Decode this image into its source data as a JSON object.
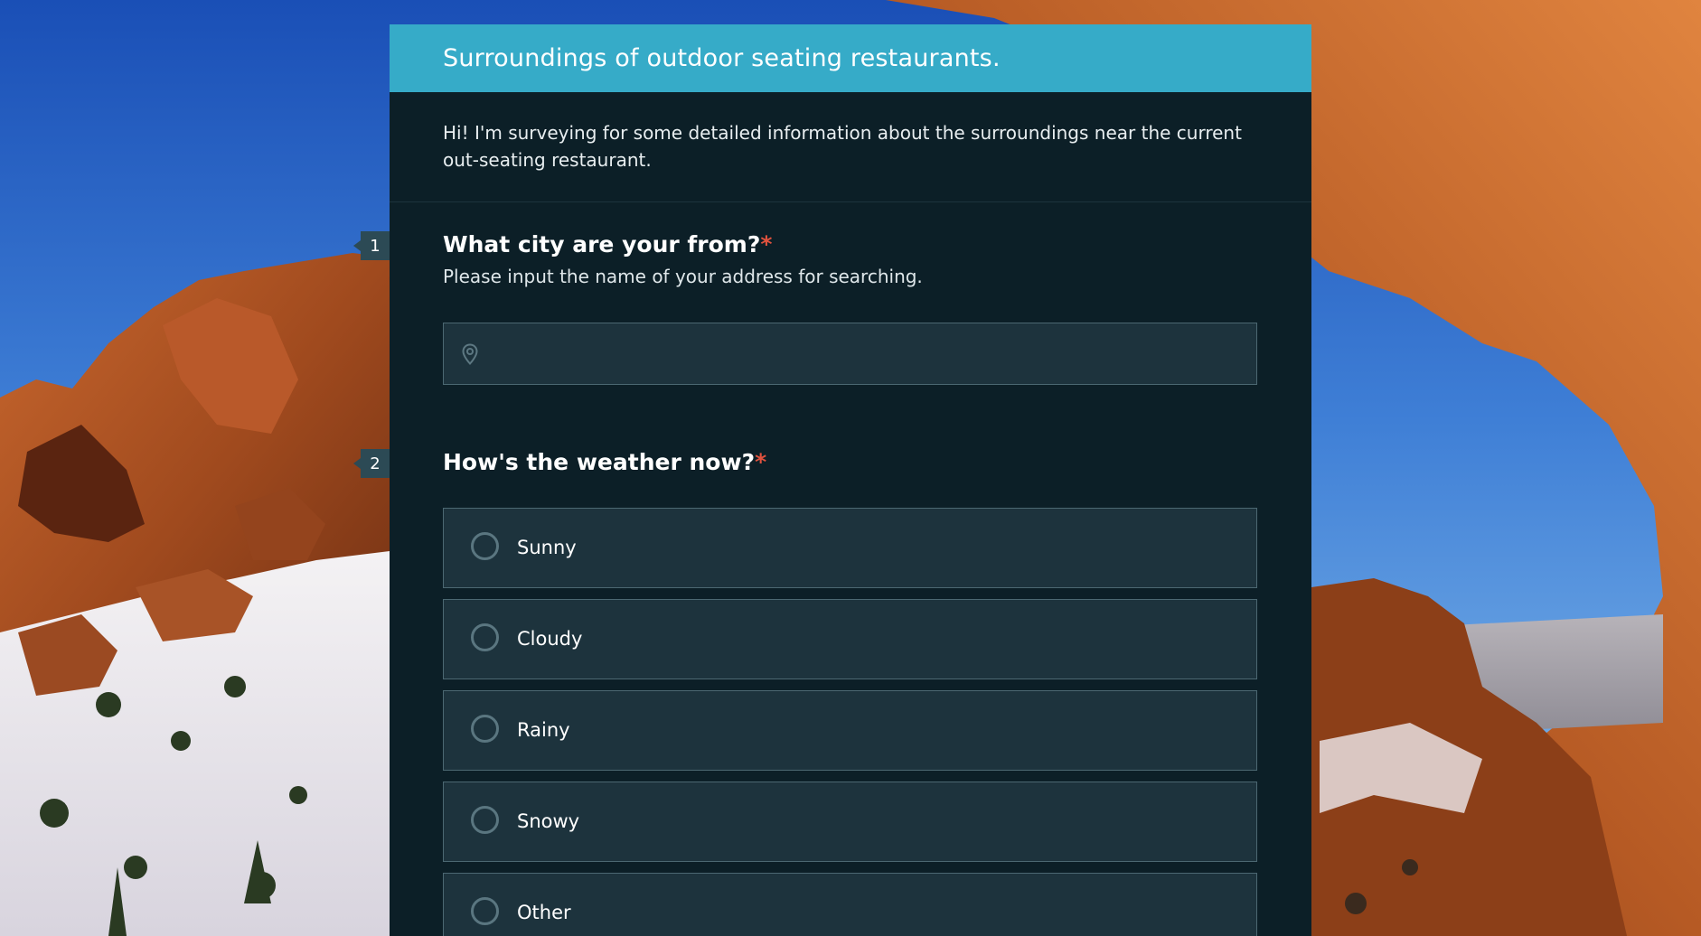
{
  "form": {
    "title": "Surroundings of outdoor seating restaurants.",
    "description": "Hi! I'm surveying for some detailed information about the surroundings near the current out-seating restaurant."
  },
  "questions": [
    {
      "number": "1",
      "title": "What city are your from?",
      "required_mark": "*",
      "hint": "Please input the name of your address for searching.",
      "input_value": "",
      "icon": "location-pin-icon"
    },
    {
      "number": "2",
      "title": "How's the weather now?",
      "required_mark": "*",
      "options": [
        {
          "label": "Sunny",
          "selected": false
        },
        {
          "label": "Cloudy",
          "selected": false
        },
        {
          "label": "Rainy",
          "selected": false
        },
        {
          "label": "Snowy",
          "selected": false
        },
        {
          "label": "Other",
          "selected": false
        }
      ]
    }
  ],
  "colors": {
    "header": "#36abc8",
    "card": "#0c1f27",
    "field": "#1d333d",
    "required": "#e0523e"
  }
}
